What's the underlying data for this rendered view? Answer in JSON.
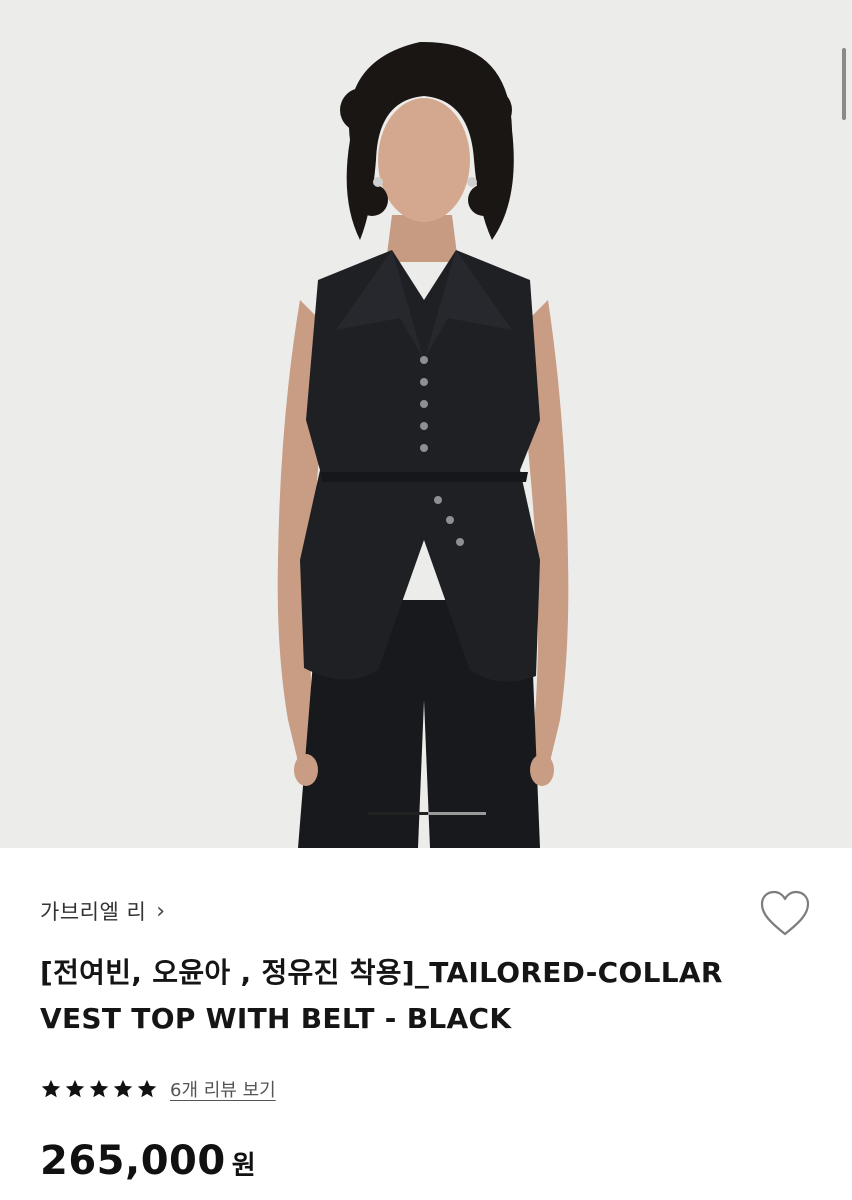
{
  "product": {
    "brand": "가브리엘 리",
    "brand_chevron": "›",
    "title": "[전여빈, 오윤아 , 정유진 착용]_TAILORED-COLLAR VEST TOP WITH BELT - BLACK",
    "rating_stars": 5,
    "review_link": "6개 리뷰 보기",
    "price": "265,000",
    "currency": "원"
  },
  "gallery": {
    "image_alt": "model wearing black sleeveless tailored-collar vest top with matching trousers",
    "active_slide": 1,
    "slide_count": 2
  },
  "icons": {
    "wishlist": "heart-outline-icon",
    "rating": "star-icon"
  },
  "colors": {
    "photo_bg": "#ececea",
    "garment": "#1c1e22",
    "text_primary": "#151515",
    "text_secondary": "#555555"
  }
}
